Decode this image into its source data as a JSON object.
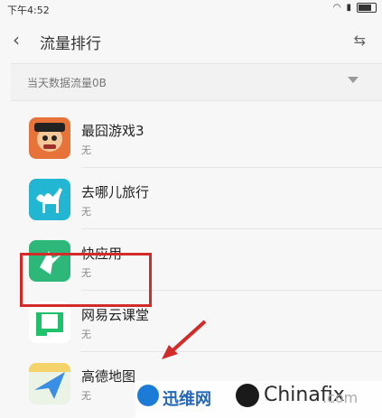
{
  "status": {
    "time": "下午4:52"
  },
  "header": {
    "title": "流量排行",
    "back_icon": "chevron-left-icon",
    "sort_icon": "swap-icon"
  },
  "filter": {
    "label": "当天数据流量0B",
    "caret_icon": "caret-down-icon"
  },
  "apps": [
    {
      "name": "最囧游戏3",
      "usage": "无",
      "icon": "game-icon",
      "color": "#e8733a"
    },
    {
      "name": "去哪儿旅行",
      "usage": "无",
      "icon": "camel-icon",
      "color": "#22b6d3"
    },
    {
      "name": "快应用",
      "usage": "无",
      "icon": "bird-icon",
      "color": "#2db87a"
    },
    {
      "name": "网易云课堂",
      "usage": "无",
      "icon": "book-icon",
      "color": "#20c16b"
    },
    {
      "name": "高德地图",
      "usage": "无",
      "icon": "map-arrow-icon",
      "color": "#3a8ee6"
    }
  ],
  "watermark": {
    "brand1": "迅维网",
    "brand2": "Chinafix",
    "brand3": ".com"
  }
}
